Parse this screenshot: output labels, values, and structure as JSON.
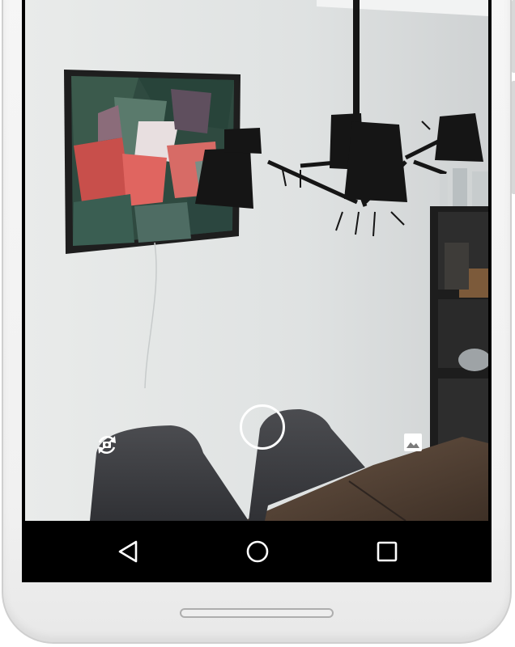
{
  "camera": {
    "switch_camera_icon": "camera-switch-icon",
    "shutter_icon": "shutter-ring-icon",
    "gallery_icon": "image-icon",
    "control_color": "#ffffff"
  },
  "navigation": {
    "back_icon": "triangle-back-icon",
    "home_icon": "circle-home-icon",
    "recents_icon": "square-recents-icon",
    "bar_color": "#000000"
  },
  "device": {
    "body_color": "#f2f2f2",
    "home_indicator_icon": "home-indicator-pill"
  }
}
